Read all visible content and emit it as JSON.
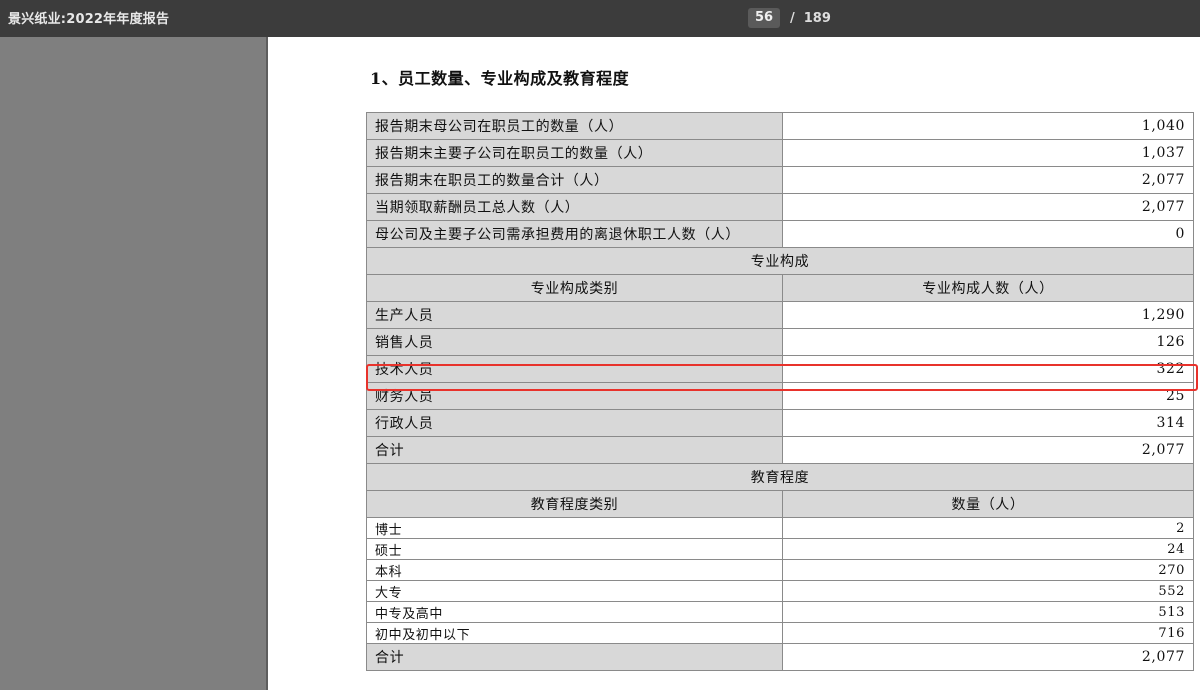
{
  "toolbar": {
    "title": "景兴纸业:2022年年度报告",
    "current_page": "56",
    "separator": "/",
    "total_pages": "189"
  },
  "document": {
    "heading": "1、员工数量、专业构成及教育程度",
    "summary_rows": [
      {
        "label": "报告期末母公司在职员工的数量（人）",
        "value": "1,040"
      },
      {
        "label": "报告期末主要子公司在职员工的数量（人）",
        "value": "1,037"
      },
      {
        "label": "报告期末在职员工的数量合计（人）",
        "value": "2,077"
      },
      {
        "label": "当期领取薪酬员工总人数（人）",
        "value": "2,077"
      },
      {
        "label": "母公司及主要子公司需承担费用的离退休职工人数（人）",
        "value": "0"
      }
    ],
    "professional": {
      "section_title": "专业构成",
      "col_category": "专业构成类别",
      "col_count": "专业构成人数（人）",
      "rows": [
        {
          "label": "生产人员",
          "value": "1,290"
        },
        {
          "label": "销售人员",
          "value": "126"
        },
        {
          "label": "技术人员",
          "value": "322"
        },
        {
          "label": "财务人员",
          "value": "25"
        },
        {
          "label": "行政人员",
          "value": "314"
        },
        {
          "label": "合计",
          "value": "2,077"
        }
      ]
    },
    "education": {
      "section_title": "教育程度",
      "col_category": "教育程度类别",
      "col_count": "数量（人）",
      "rows": [
        {
          "label": "博士",
          "value": "2"
        },
        {
          "label": "硕士",
          "value": "24"
        },
        {
          "label": "本科",
          "value": "270"
        },
        {
          "label": "大专",
          "value": "552"
        },
        {
          "label": "中专及高中",
          "value": "513"
        },
        {
          "label": "初中及初中以下",
          "value": "716"
        }
      ],
      "total": {
        "label": "合计",
        "value": "2,077"
      }
    }
  },
  "colors": {
    "highlight_border": "#e8322b",
    "label_cell_bg": "#d8d8d8",
    "toolbar_bg": "#3c3c3c"
  }
}
